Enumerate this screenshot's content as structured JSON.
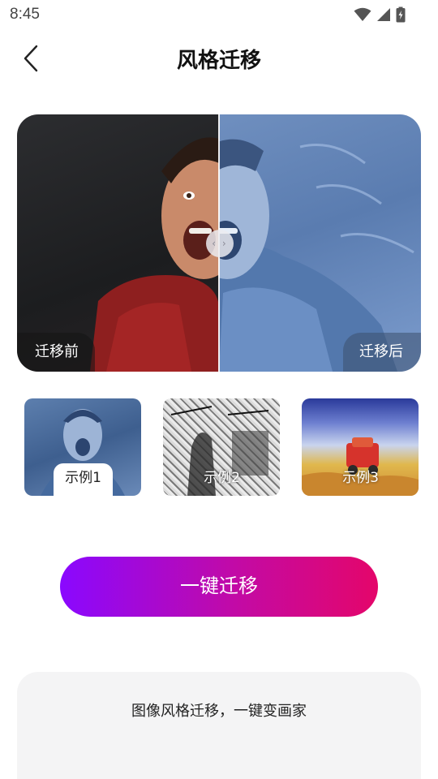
{
  "status": {
    "time": "8:45"
  },
  "header": {
    "title": "风格迁移"
  },
  "compare": {
    "before_label": "迁移前",
    "after_label": "迁移后",
    "handle_glyph": "‹ ›"
  },
  "examples": [
    {
      "label": "示例1",
      "selected": true
    },
    {
      "label": "示例2",
      "selected": false
    },
    {
      "label": "示例3",
      "selected": false
    }
  ],
  "action": {
    "label": "一键迁移"
  },
  "info": {
    "text": "图像风格迁移，一键变画家"
  },
  "colors": {
    "button_gradient_start": "#8a08ff",
    "button_gradient_end": "#e4066a",
    "card_background": "#f4f4f5"
  }
}
